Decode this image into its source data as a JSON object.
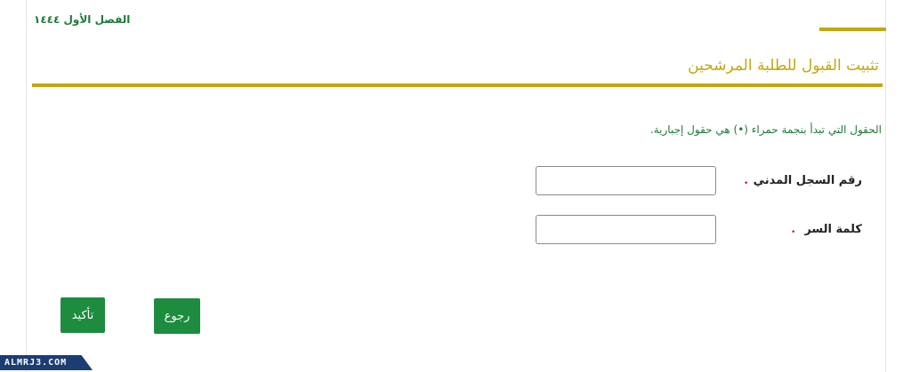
{
  "header": {
    "semester_label": "الفصل الأول ١٤٤٤",
    "page_title": "تثبيت القبول للطلبة المرشحين"
  },
  "form": {
    "required_note": "الحقول التي تبدأ بنجمة حمراء (•) هي حقول إجبارية.",
    "required_marker": "•",
    "fields": [
      {
        "label": "رقم السجل المدني",
        "value": "",
        "placeholder": ""
      },
      {
        "label": "كلمة السر",
        "value": "",
        "placeholder": ""
      }
    ]
  },
  "actions": {
    "confirm_label": "تأكيد",
    "back_label": "رجوع"
  },
  "watermark": {
    "text": "ALMRJ3.COM"
  },
  "colors": {
    "accent_gold": "#c2a60e",
    "brand_green": "#1e8c3f",
    "text_green": "#1f7a3a",
    "required_red": "#cc1f1f"
  }
}
